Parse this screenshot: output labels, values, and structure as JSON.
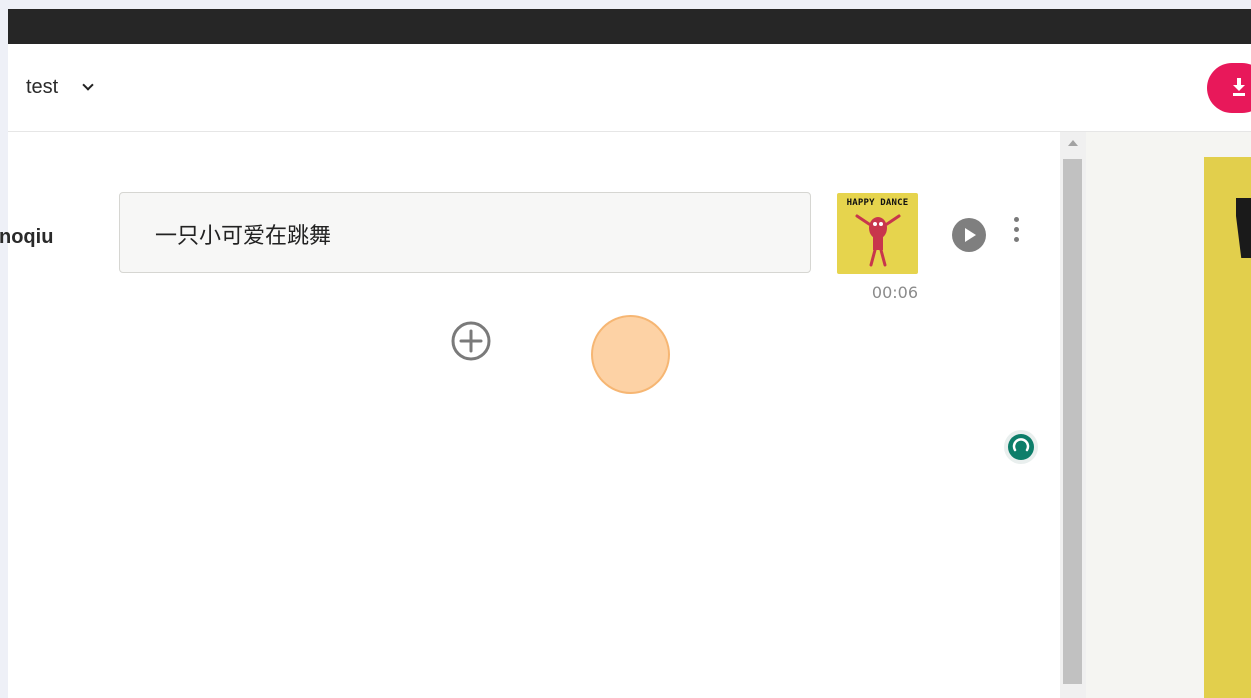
{
  "header": {
    "project_name": "test",
    "download_icon": "download-icon",
    "accent_color": "#e8185a"
  },
  "row": {
    "speaker": "noqiu",
    "text": "一只小可爱在跳舞",
    "thumbnail_title": "HAPPY DANCE",
    "duration": "00:06",
    "play_icon": "play-icon",
    "more_icon": "more-vertical-icon"
  },
  "add_icon": "add-circle-icon",
  "status_icon": "loading-icon",
  "status_color": "#0d7e6a"
}
